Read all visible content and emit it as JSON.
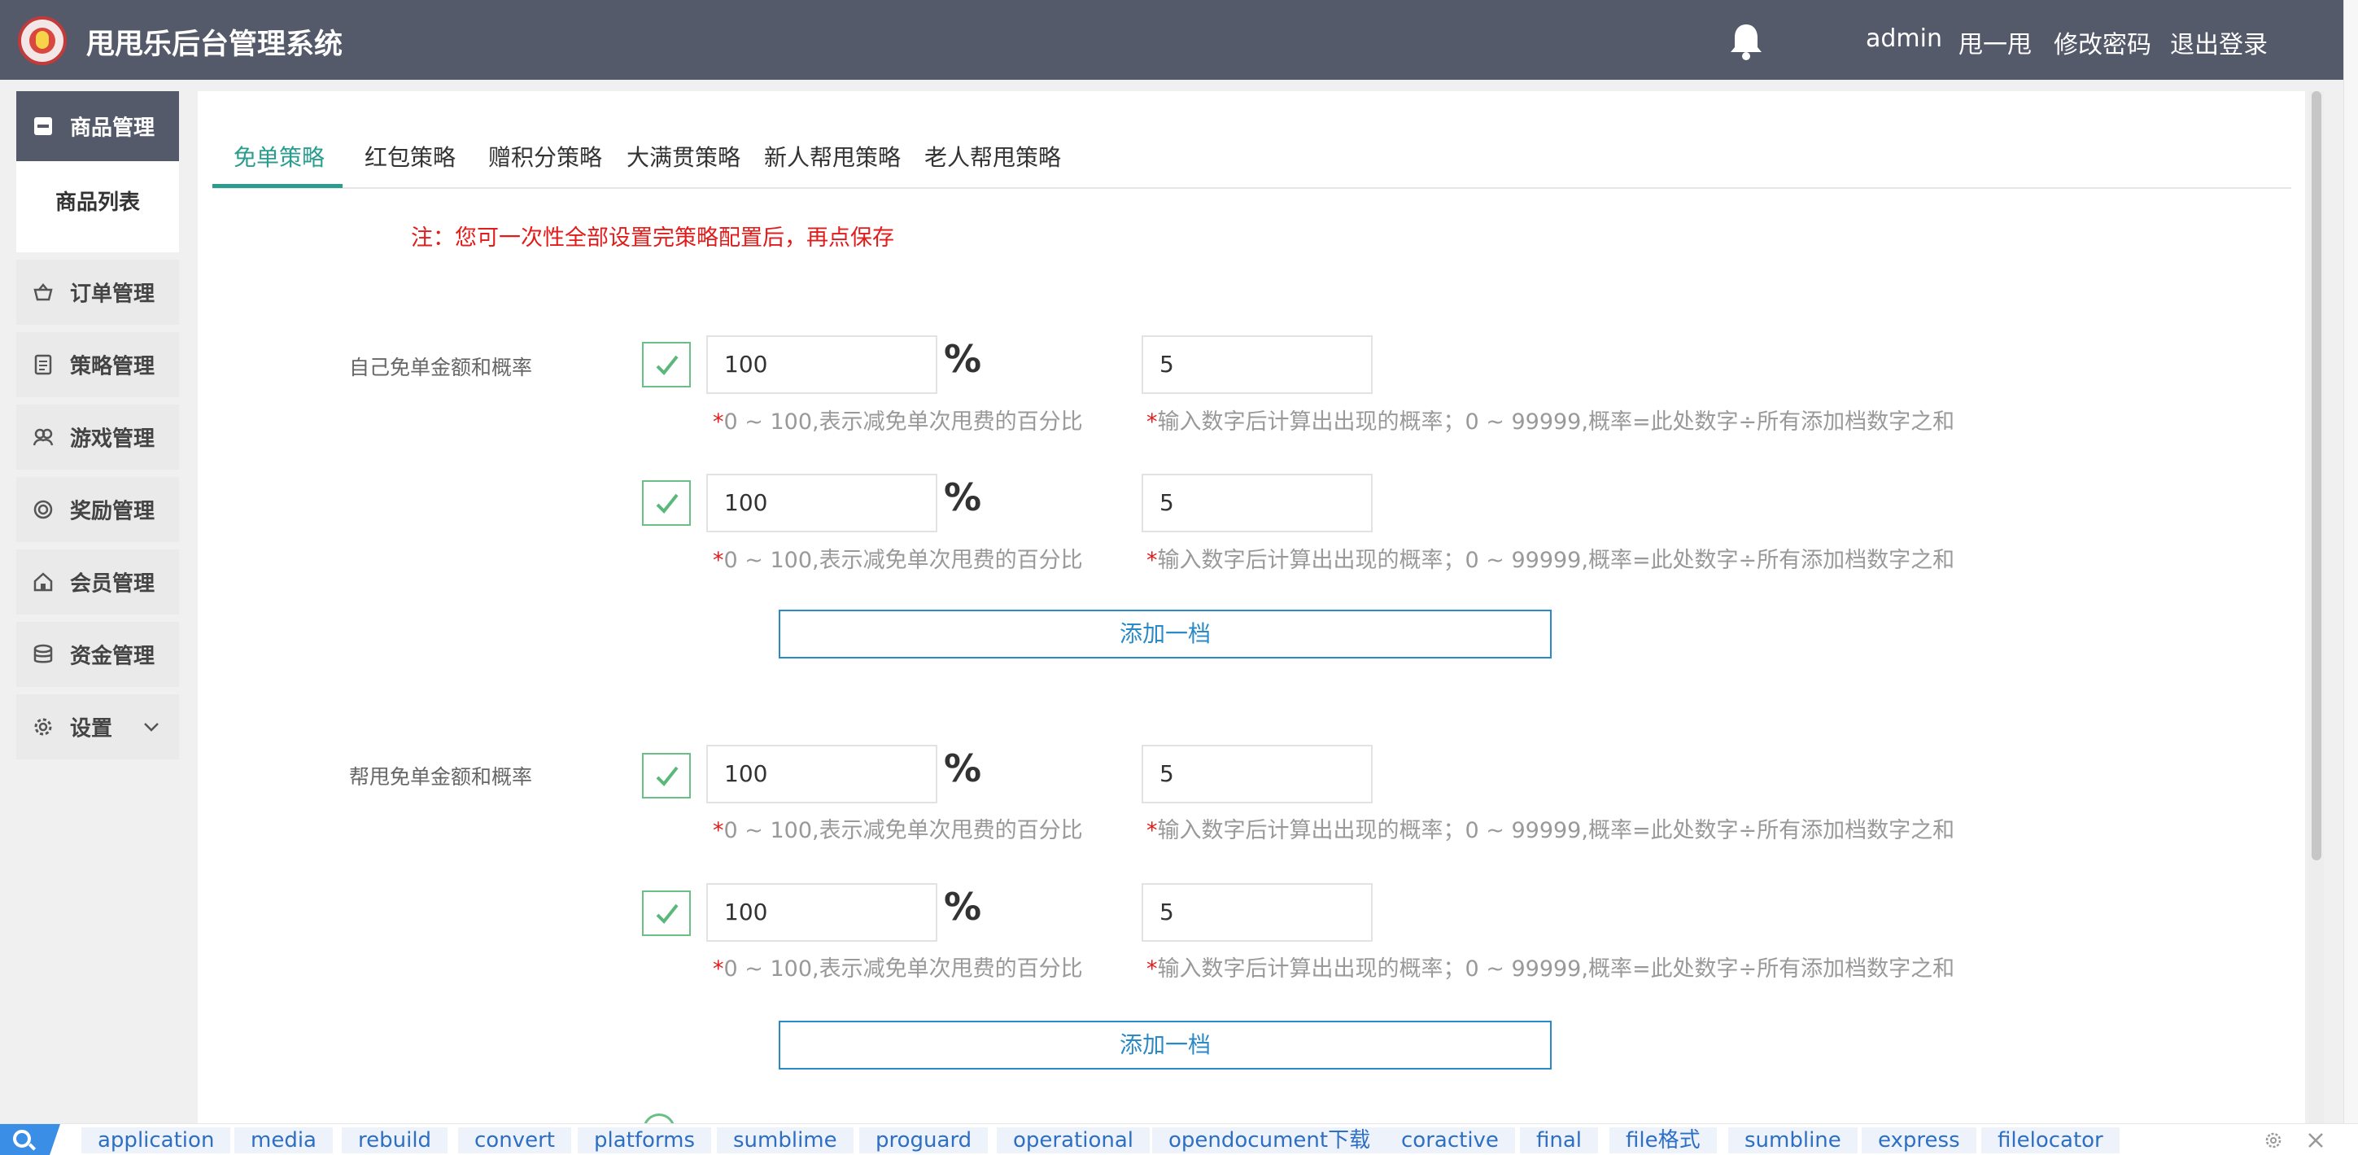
{
  "header": {
    "title": "甩甩乐后台管理系统",
    "links": [
      "admin",
      "甩一甩",
      "修改密码",
      "退出登录"
    ]
  },
  "sidebar": {
    "items": [
      {
        "label": "商品管理",
        "icon": "product-box-icon"
      },
      {
        "label": "订单管理",
        "icon": "basket-icon"
      },
      {
        "label": "策略管理",
        "icon": "document-icon"
      },
      {
        "label": "游戏管理",
        "icon": "users-icon"
      },
      {
        "label": "奖励管理",
        "icon": "target-icon"
      },
      {
        "label": "会员管理",
        "icon": "home-icon"
      },
      {
        "label": "资金管理",
        "icon": "coins-icon"
      },
      {
        "label": "设置",
        "icon": "gear-icon"
      }
    ],
    "sub_item": "商品列表"
  },
  "tabs": [
    "免单策略",
    "红包策略",
    "赠积分策略",
    "大满贯策略",
    "新人帮甩策略",
    "老人帮甩策略"
  ],
  "active_tab": "免单策略",
  "note": "注：您可一次性全部设置完策略配置后，再点保存",
  "sections": [
    {
      "label": "自己免单金额和概率",
      "rows": [
        {
          "checked": true,
          "percent": "100",
          "weight": "5"
        },
        {
          "checked": true,
          "percent": "100",
          "weight": "5"
        }
      ],
      "add_label": "添加一档"
    },
    {
      "label": "帮甩免单金额和概率",
      "rows": [
        {
          "checked": true,
          "percent": "100",
          "weight": "5"
        },
        {
          "checked": true,
          "percent": "100",
          "weight": "5"
        }
      ],
      "add_label": "添加一档"
    }
  ],
  "percent_sign": "%",
  "hint_star": "*",
  "hint_percent": "0 ~ 100,表示减免单次甩费的百分比",
  "hint_weight": "输入数字后计算出出现的概率；0 ~ 99999,概率=此处数字÷所有添加档数字之和",
  "tagbar": {
    "tags": [
      "application",
      "media",
      "rebuild",
      "convert",
      "platforms",
      "sumblime",
      "proguard",
      "operational",
      "opendocument下载",
      "coractive",
      "final",
      "file格式",
      "sumbline",
      "express",
      "filelocator"
    ]
  },
  "colors": {
    "header_bg": "#545a6a",
    "accent_green": "#2a9d8f",
    "note_red": "#e21b1b",
    "button_blue": "#2a8ac7",
    "check_green": "#5cb87a"
  }
}
